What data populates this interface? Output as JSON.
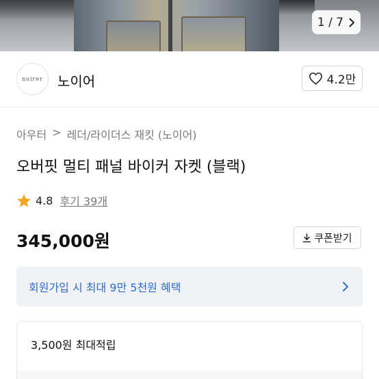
{
  "gallery": {
    "counter": "1 / 7",
    "next_icon": "chevron-right-icon"
  },
  "brand": {
    "logo_text": "noirer",
    "name": "노이어",
    "likes": "4.2만",
    "like_icon": "heart-outline-icon"
  },
  "breadcrumb": {
    "items": [
      "아우터",
      "레더/라이더스 재킷 (노이어)"
    ],
    "separator": ">"
  },
  "product": {
    "title": "오버핏 멀티 패널 바이커 자켓 (블랙)",
    "rating": "4.8",
    "reviews_label": "후기 39개",
    "price": "345,000원"
  },
  "coupon": {
    "label": "쿠폰받기",
    "icon": "download-icon"
  },
  "promo": {
    "text": "회원가입 시 최대 9만 5천원 혜택",
    "accent": "#2a6fd6"
  },
  "points": {
    "text": "3,500원 최대적립"
  },
  "colors": {
    "star": "#f5a623",
    "promo_bg": "#f1f2f5"
  }
}
